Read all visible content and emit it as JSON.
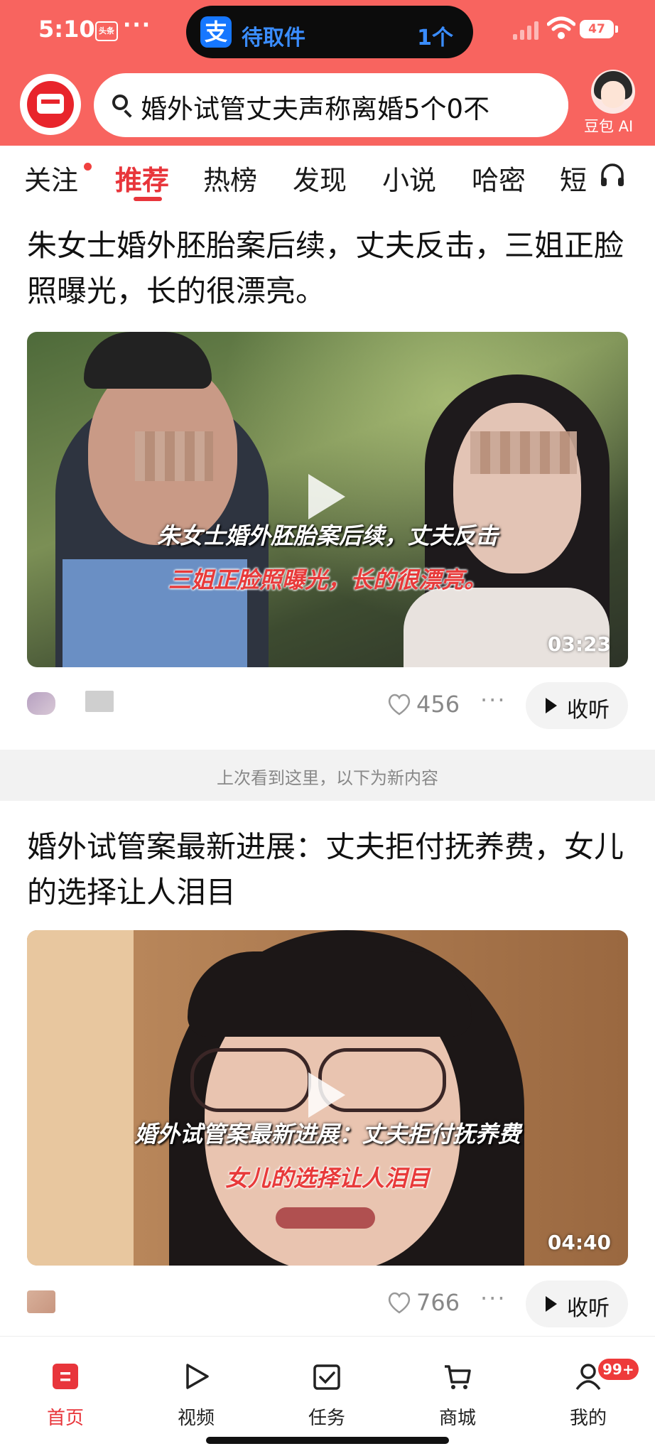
{
  "status_bar": {
    "time": "5:10",
    "small_icon_text": "头条",
    "dots": "···",
    "island_text": "待取件",
    "island_count": "1个",
    "island_logo": "支",
    "battery": "47"
  },
  "search": {
    "query": "婚外试管丈夫声称离婚5个0不"
  },
  "doubao": {
    "label": "豆包 AI"
  },
  "tabs": [
    {
      "label": "关注"
    },
    {
      "label": "推荐"
    },
    {
      "label": "热榜"
    },
    {
      "label": "发现"
    },
    {
      "label": "小说"
    },
    {
      "label": "哈密"
    },
    {
      "label": "短"
    }
  ],
  "feed": [
    {
      "title": "朱女士婚外胚胎案后续，丈夫反击，三姐正脸照曝光，长的很漂亮。",
      "overlay_line1": "朱女士婚外胚胎案后续，丈夫反击",
      "overlay_line2": "三姐正脸照曝光，长的很漂亮。",
      "duration": "03:23",
      "likes": "456",
      "listen_label": "收听"
    },
    {
      "title": "婚外试管案最新进展：丈夫拒付抚养费，女儿的选择让人泪目",
      "overlay_line1": "婚外试管案最新进展：丈夫拒付抚养费",
      "overlay_line2": "女儿的选择让人泪目",
      "duration": "04:40",
      "likes": "766",
      "listen_label": "收听"
    }
  ],
  "divider": {
    "text": "上次看到这里，以下为新内容"
  },
  "bottom_nav": [
    {
      "label": "首页",
      "icon": "home-icon"
    },
    {
      "label": "视频",
      "icon": "video-icon"
    },
    {
      "label": "任务",
      "icon": "task-icon"
    },
    {
      "label": "商城",
      "icon": "cart-icon"
    },
    {
      "label": "我的",
      "icon": "profile-icon"
    }
  ],
  "badge": {
    "text": "99+"
  },
  "colors": {
    "brand_red": "#f8645f",
    "accent_red": "#e8353b"
  }
}
